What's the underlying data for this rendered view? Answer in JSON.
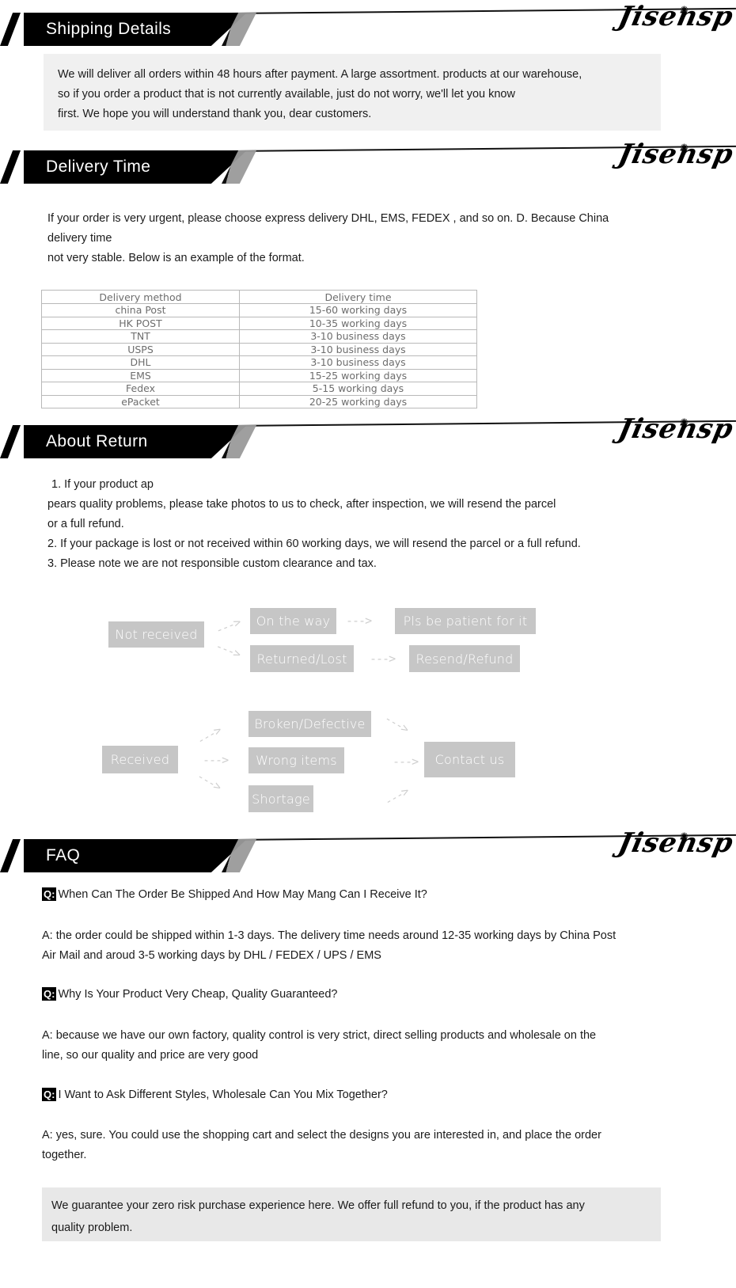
{
  "brand": {
    "name": "Jisensp",
    "butterfly_icon": "butterfly-icon"
  },
  "sections": {
    "shipping": {
      "title": "Shipping Details",
      "lines": [
        "We will deliver all orders within 48 hours after payment. A large assortment. products at our warehouse,",
        "so if you order a product that is not currently available, just do not worry, we'll let you know",
        "first. We hope you will understand thank you, dear customers."
      ]
    },
    "delivery": {
      "title": "Delivery  Time",
      "lines": [
        "If your order is very urgent, please choose express delivery DHL, EMS, FEDEX , and so on. D. Because China",
        "delivery time",
        "not very stable. Below is an example of the format."
      ],
      "table": {
        "headers": [
          "Delivery method",
          "Delivery time"
        ],
        "rows": [
          [
            "china Post",
            "15-60 working days"
          ],
          [
            "HK POST",
            "10-35 working days"
          ],
          [
            "TNT",
            "3-10 business days"
          ],
          [
            "USPS",
            "3-10 business days"
          ],
          [
            "DHL",
            "3-10 business days"
          ],
          [
            "EMS",
            "15-25 working days"
          ],
          [
            "Fedex",
            "5-15 working days"
          ],
          [
            "ePacket",
            "20-25 working days"
          ]
        ]
      }
    },
    "about_return": {
      "title": "About Return",
      "lines": [
        "1. If your product ap",
        "pears quality problems, please take photos to us to check, after inspection, we will resend the parcel",
        "or a full refund.",
        "2. If your package is lost or not received within 60 working days, we will resend the parcel or a full refund.",
        "3. Please note we are not responsible custom clearance and tax."
      ],
      "flow_not_received": {
        "start": "Not received",
        "branch_a": "On the way",
        "branch_b": "Returned/Lost",
        "result_a": "Pls be patient for it",
        "result_b": "Resend/Refund",
        "arrow": "--->"
      },
      "flow_received": {
        "start": "Received",
        "branch_a": "Broken/Defective",
        "branch_b": "Wrong items",
        "branch_c": "Shortage",
        "result": "Contact us",
        "arrow": "--->"
      }
    },
    "faq": {
      "title": "FAQ",
      "q_badge": "Q:",
      "items": [
        {
          "question": "When Can The Order Be Shipped And How May Mang Can I Receive It?",
          "answer_lines": [
            "A: the order could be shipped within 1-3 days. The delivery time needs around 12-35 working days by China Post",
            "Air Mail and aroud 3-5 working days by DHL / FEDEX / UPS / EMS"
          ]
        },
        {
          "question": "Why Is Your Product Very Cheap, Quality Guaranteed?",
          "answer_lines": [
            "A: because we have our own factory, quality control is very strict, direct selling products and wholesale on the",
            "line, so our quality and price are very good"
          ]
        },
        {
          "question": "I Want to Ask Different Styles, Wholesale Can You Mix Together?",
          "answer_lines": [
            "A: yes, sure. You could use the shopping cart and select the designs you are interested in, and place the order",
            "together."
          ]
        }
      ],
      "guarantee_lines": [
        "We guarantee your zero risk purchase experience here. We offer full refund to you, if the product has any",
        "quality problem."
      ]
    }
  },
  "colors": {
    "banner": "#000000",
    "banner_tail": "#9a9a9a",
    "info_box": "#f0f0f0",
    "guarantee_box": "#e8e8e8",
    "flow_box": "#c6c6c6",
    "flow_arrow": "#cfcfcf",
    "table_border": "#b9b9b9",
    "table_text": "#6d6d6d"
  }
}
